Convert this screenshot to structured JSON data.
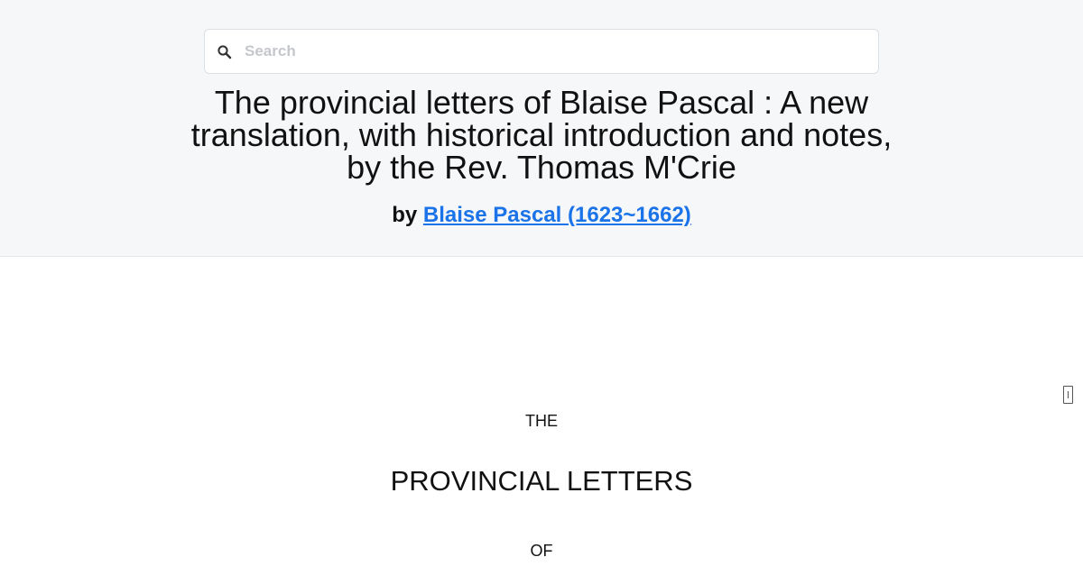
{
  "search": {
    "placeholder": "Search",
    "value": "",
    "icon": "search-icon"
  },
  "book": {
    "title": "The provincial letters of Blaise Pascal : A new translation, with historical introduction and notes, by the Rev. Thomas M'Crie",
    "by_label": "by",
    "author": "Blaise Pascal (1623~1662)"
  },
  "content": {
    "line1": "THE",
    "line2": "PROVINCIAL LETTERS",
    "line3": "OF"
  },
  "side_icon": "page-marker-icon",
  "colors": {
    "header_bg": "#f6f7f9",
    "link": "#1a73e8",
    "text": "#111111"
  }
}
